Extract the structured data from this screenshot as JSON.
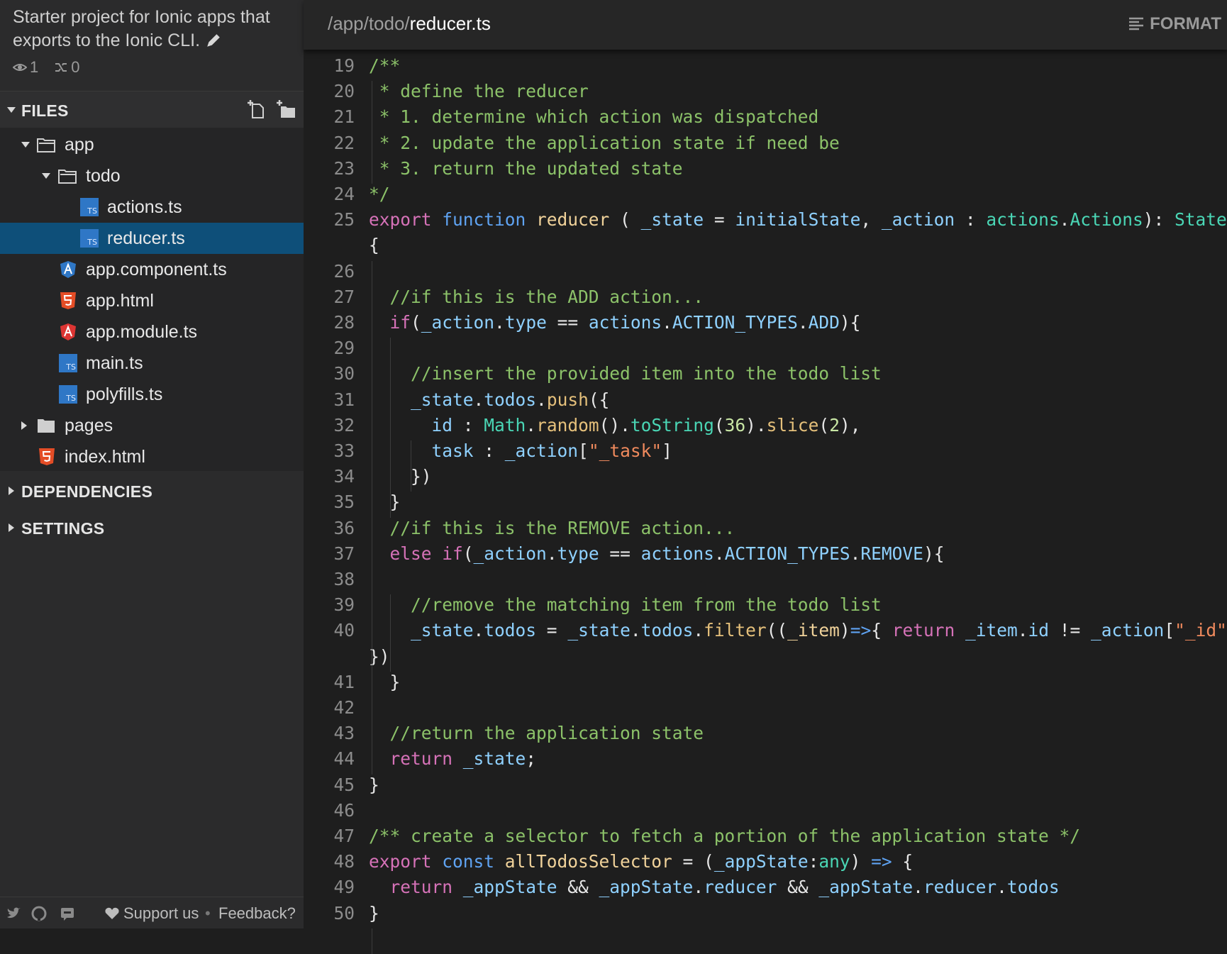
{
  "sidebar": {
    "description": "Starter project for Ionic apps that exports to the Ionic CLI.",
    "views": "1",
    "forks": "0",
    "files_label": "FILES",
    "tree": [
      {
        "label": "app",
        "kind": "folder-open"
      },
      {
        "label": "todo",
        "kind": "folder-open"
      },
      {
        "label": "actions.ts",
        "kind": "ts"
      },
      {
        "label": "reducer.ts",
        "kind": "ts",
        "selected": true
      },
      {
        "label": "app.component.ts",
        "kind": "angular-blue"
      },
      {
        "label": "app.html",
        "kind": "html"
      },
      {
        "label": "app.module.ts",
        "kind": "angular-red"
      },
      {
        "label": "main.ts",
        "kind": "ts"
      },
      {
        "label": "polyfills.ts",
        "kind": "ts"
      },
      {
        "label": "pages",
        "kind": "folder-closed"
      },
      {
        "label": "index.html",
        "kind": "html"
      }
    ],
    "dependencies_label": "DEPENDENCIES",
    "settings_label": "SETTINGS",
    "footer": {
      "support": "Support us",
      "feedback": "Feedback?"
    }
  },
  "editor": {
    "path_prefix": "/app/todo/",
    "file_name": "reducer.ts",
    "format_label": "FORMAT",
    "lines": [
      {
        "n": "19",
        "tokens": [
          [
            "cm",
            "/**"
          ]
        ]
      },
      {
        "n": "20",
        "tokens": [
          [
            "cm",
            " * define the reducer"
          ]
        ]
      },
      {
        "n": "21",
        "tokens": [
          [
            "cm",
            " * 1. determine which action was dispatched"
          ]
        ]
      },
      {
        "n": "22",
        "tokens": [
          [
            "cm",
            " * 2. update the application state if need be"
          ]
        ]
      },
      {
        "n": "23",
        "tokens": [
          [
            "cm",
            " * 3. return the updated state"
          ]
        ]
      },
      {
        "n": "24",
        "tokens": [
          [
            "cm",
            "*/"
          ]
        ]
      },
      {
        "n": "25",
        "tokens": [
          [
            "kw",
            "export "
          ],
          [
            "fn",
            "function "
          ],
          [
            "nm",
            "reducer"
          ],
          [
            "pn",
            " ( "
          ],
          [
            "id",
            "_state"
          ],
          [
            "pn",
            " = "
          ],
          [
            "id",
            "initialState"
          ],
          [
            "pn",
            ", "
          ],
          [
            "id",
            "_action"
          ],
          [
            "pn",
            " : "
          ],
          [
            "ty",
            "actions"
          ],
          [
            "pn",
            "."
          ],
          [
            "ty",
            "Actions"
          ],
          [
            "pn",
            "): "
          ],
          [
            "ty",
            "State"
          ]
        ]
      },
      {
        "n": "",
        "tokens": [
          [
            "pn",
            "{"
          ]
        ]
      },
      {
        "n": "26",
        "tokens": []
      },
      {
        "n": "27",
        "tokens": [
          [
            "cm",
            "  //if this is the ADD action..."
          ]
        ]
      },
      {
        "n": "28",
        "tokens": [
          [
            "kw",
            "  if"
          ],
          [
            "pn",
            "("
          ],
          [
            "id",
            "_action"
          ],
          [
            "pn",
            "."
          ],
          [
            "id",
            "type"
          ],
          [
            "pn",
            " == "
          ],
          [
            "id",
            "actions"
          ],
          [
            "pn",
            "."
          ],
          [
            "id",
            "ACTION_TYPES"
          ],
          [
            "pn",
            "."
          ],
          [
            "id",
            "ADD"
          ],
          [
            "pn",
            "){"
          ]
        ]
      },
      {
        "n": "29",
        "tokens": []
      },
      {
        "n": "30",
        "tokens": [
          [
            "cm",
            "    //insert the provided item into the todo list"
          ]
        ]
      },
      {
        "n": "31",
        "tokens": [
          [
            "id",
            "    _state"
          ],
          [
            "pn",
            "."
          ],
          [
            "id",
            "todos"
          ],
          [
            "pn",
            "."
          ],
          [
            "mt",
            "push"
          ],
          [
            "pn",
            "({"
          ]
        ]
      },
      {
        "n": "32",
        "tokens": [
          [
            "id",
            "      id"
          ],
          [
            "pn",
            " : "
          ],
          [
            "ty",
            "Math"
          ],
          [
            "pn",
            "."
          ],
          [
            "mt",
            "random"
          ],
          [
            "pn",
            "()."
          ],
          [
            "ty",
            "toString"
          ],
          [
            "pn",
            "("
          ],
          [
            "nu",
            "36"
          ],
          [
            "pn",
            ")."
          ],
          [
            "mt",
            "slice"
          ],
          [
            "pn",
            "("
          ],
          [
            "nu",
            "2"
          ],
          [
            "pn",
            "),"
          ]
        ]
      },
      {
        "n": "33",
        "tokens": [
          [
            "id",
            "      task"
          ],
          [
            "pn",
            " : "
          ],
          [
            "id",
            "_action"
          ],
          [
            "pn",
            "["
          ],
          [
            "st",
            "\"_task\""
          ],
          [
            "pn",
            "]"
          ]
        ]
      },
      {
        "n": "34",
        "tokens": [
          [
            "pn",
            "    })"
          ]
        ]
      },
      {
        "n": "35",
        "tokens": [
          [
            "pn",
            "  }"
          ]
        ]
      },
      {
        "n": "36",
        "tokens": [
          [
            "cm",
            "  //if this is the REMOVE action..."
          ]
        ]
      },
      {
        "n": "37",
        "tokens": [
          [
            "kw",
            "  else "
          ],
          [
            "kw",
            "if"
          ],
          [
            "pn",
            "("
          ],
          [
            "id",
            "_action"
          ],
          [
            "pn",
            "."
          ],
          [
            "id",
            "type"
          ],
          [
            "pn",
            " == "
          ],
          [
            "id",
            "actions"
          ],
          [
            "pn",
            "."
          ],
          [
            "id",
            "ACTION_TYPES"
          ],
          [
            "pn",
            "."
          ],
          [
            "id",
            "REMOVE"
          ],
          [
            "pn",
            "){"
          ]
        ]
      },
      {
        "n": "38",
        "tokens": []
      },
      {
        "n": "39",
        "tokens": [
          [
            "cm",
            "    //remove the matching item from the todo list"
          ]
        ]
      },
      {
        "n": "40",
        "tokens": [
          [
            "id",
            "    _state"
          ],
          [
            "pn",
            "."
          ],
          [
            "id",
            "todos"
          ],
          [
            "pn",
            " = "
          ],
          [
            "id",
            "_state"
          ],
          [
            "pn",
            "."
          ],
          [
            "id",
            "todos"
          ],
          [
            "pn",
            "."
          ],
          [
            "mt",
            "filter"
          ],
          [
            "pn",
            "(("
          ],
          [
            "nm",
            "_item"
          ],
          [
            "pn",
            ")"
          ],
          [
            "fn",
            "=>"
          ],
          [
            "pn",
            "{ "
          ],
          [
            "kw",
            "return "
          ],
          [
            "id",
            "_item"
          ],
          [
            "pn",
            "."
          ],
          [
            "id",
            "id"
          ],
          [
            "pn",
            " != "
          ],
          [
            "id",
            "_action"
          ],
          [
            "pn",
            "["
          ],
          [
            "st",
            "\"_id\""
          ],
          [
            "pn",
            "]"
          ]
        ]
      },
      {
        "n": "",
        "tokens": [
          [
            "pn",
            "})"
          ]
        ]
      },
      {
        "n": "41",
        "tokens": [
          [
            "pn",
            "  }"
          ]
        ]
      },
      {
        "n": "42",
        "tokens": []
      },
      {
        "n": "43",
        "tokens": [
          [
            "cm",
            "  //return the application state"
          ]
        ]
      },
      {
        "n": "44",
        "tokens": [
          [
            "kw",
            "  return "
          ],
          [
            "id",
            "_state"
          ],
          [
            "pn",
            ";"
          ]
        ]
      },
      {
        "n": "45",
        "tokens": [
          [
            "pn",
            "}"
          ]
        ]
      },
      {
        "n": "46",
        "tokens": []
      },
      {
        "n": "47",
        "tokens": [
          [
            "cm",
            "/** create a selector to fetch a portion of the application state */"
          ]
        ]
      },
      {
        "n": "48",
        "tokens": [
          [
            "kw",
            "export "
          ],
          [
            "fn",
            "const "
          ],
          [
            "nm",
            "allTodosSelector"
          ],
          [
            "pn",
            " = ("
          ],
          [
            "id",
            "_appState"
          ],
          [
            "pn",
            ":"
          ],
          [
            "ty",
            "any"
          ],
          [
            "pn",
            ") "
          ],
          [
            "fn",
            "=>"
          ],
          [
            "pn",
            " {"
          ]
        ]
      },
      {
        "n": "49",
        "tokens": [
          [
            "kw",
            "  return "
          ],
          [
            "id",
            "_appState"
          ],
          [
            "pn",
            " && "
          ],
          [
            "id",
            "_appState"
          ],
          [
            "pn",
            "."
          ],
          [
            "id",
            "reducer"
          ],
          [
            "pn",
            " && "
          ],
          [
            "id",
            "_appState"
          ],
          [
            "pn",
            "."
          ],
          [
            "id",
            "reducer"
          ],
          [
            "pn",
            "."
          ],
          [
            "id",
            "todos"
          ]
        ]
      },
      {
        "n": "50",
        "tokens": [
          [
            "pn",
            "}"
          ]
        ]
      }
    ]
  }
}
